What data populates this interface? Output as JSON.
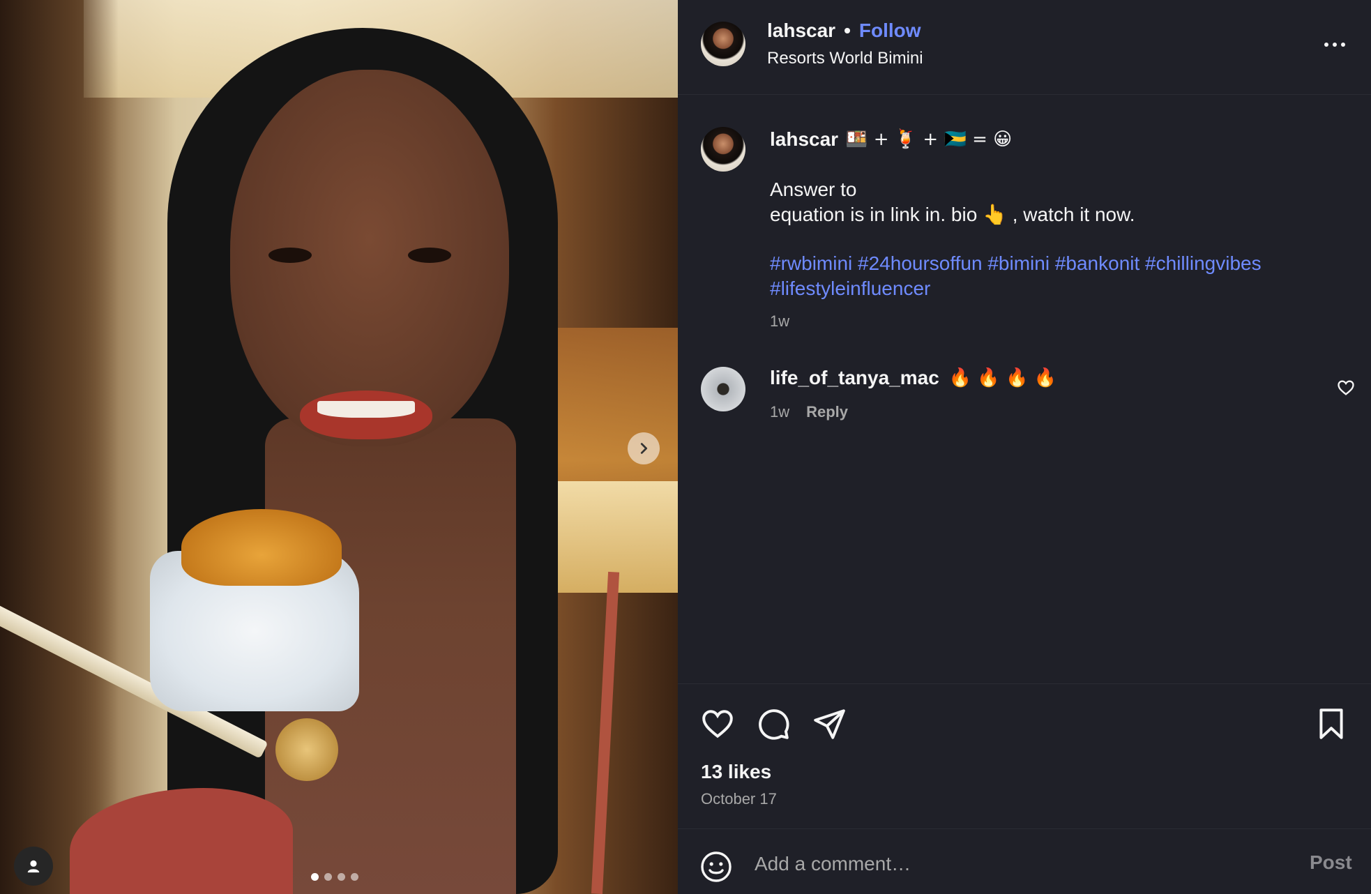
{
  "media": {
    "slide_count": 4,
    "active_slide": 1,
    "next_icon": "chevron-right-icon",
    "tag_icon": "user-icon"
  },
  "header": {
    "username": "lahscar",
    "separator": "•",
    "follow_label": "Follow",
    "location": "Resorts World Bimini",
    "more_icon": "more-horizontal-icon"
  },
  "caption": {
    "username": "lahscar",
    "emoji_equation": "🍱 + 🍹 + 🇧🇸 = 😀",
    "text_lines": [
      "Answer to",
      "equation is in link in. bio 👆 , watch it now."
    ],
    "hashtags": [
      "#rwbimini",
      "#24hoursoffun",
      "#bimini",
      "#bankonit",
      "#chillingvibes",
      "#lifestyleinfluencer"
    ],
    "time": "1w"
  },
  "comments": [
    {
      "username": "life_of_tanya_mac",
      "text": "🔥 🔥 🔥 🔥",
      "time": "1w",
      "reply_label": "Reply",
      "like_icon": "heart-outline-icon"
    }
  ],
  "actions": {
    "like_icon": "heart-outline-icon",
    "comment_icon": "comment-bubble-icon",
    "share_icon": "paper-plane-icon",
    "save_icon": "bookmark-icon"
  },
  "stats": {
    "likes": "13 likes",
    "date": "October 17"
  },
  "comment_box": {
    "placeholder": "Add a comment…",
    "post_label": "Post",
    "emoji_icon": "smiley-icon"
  },
  "colors": {
    "background": "#1f2028",
    "accent": "#6f8bff",
    "muted_text": "#a8a8a8"
  }
}
